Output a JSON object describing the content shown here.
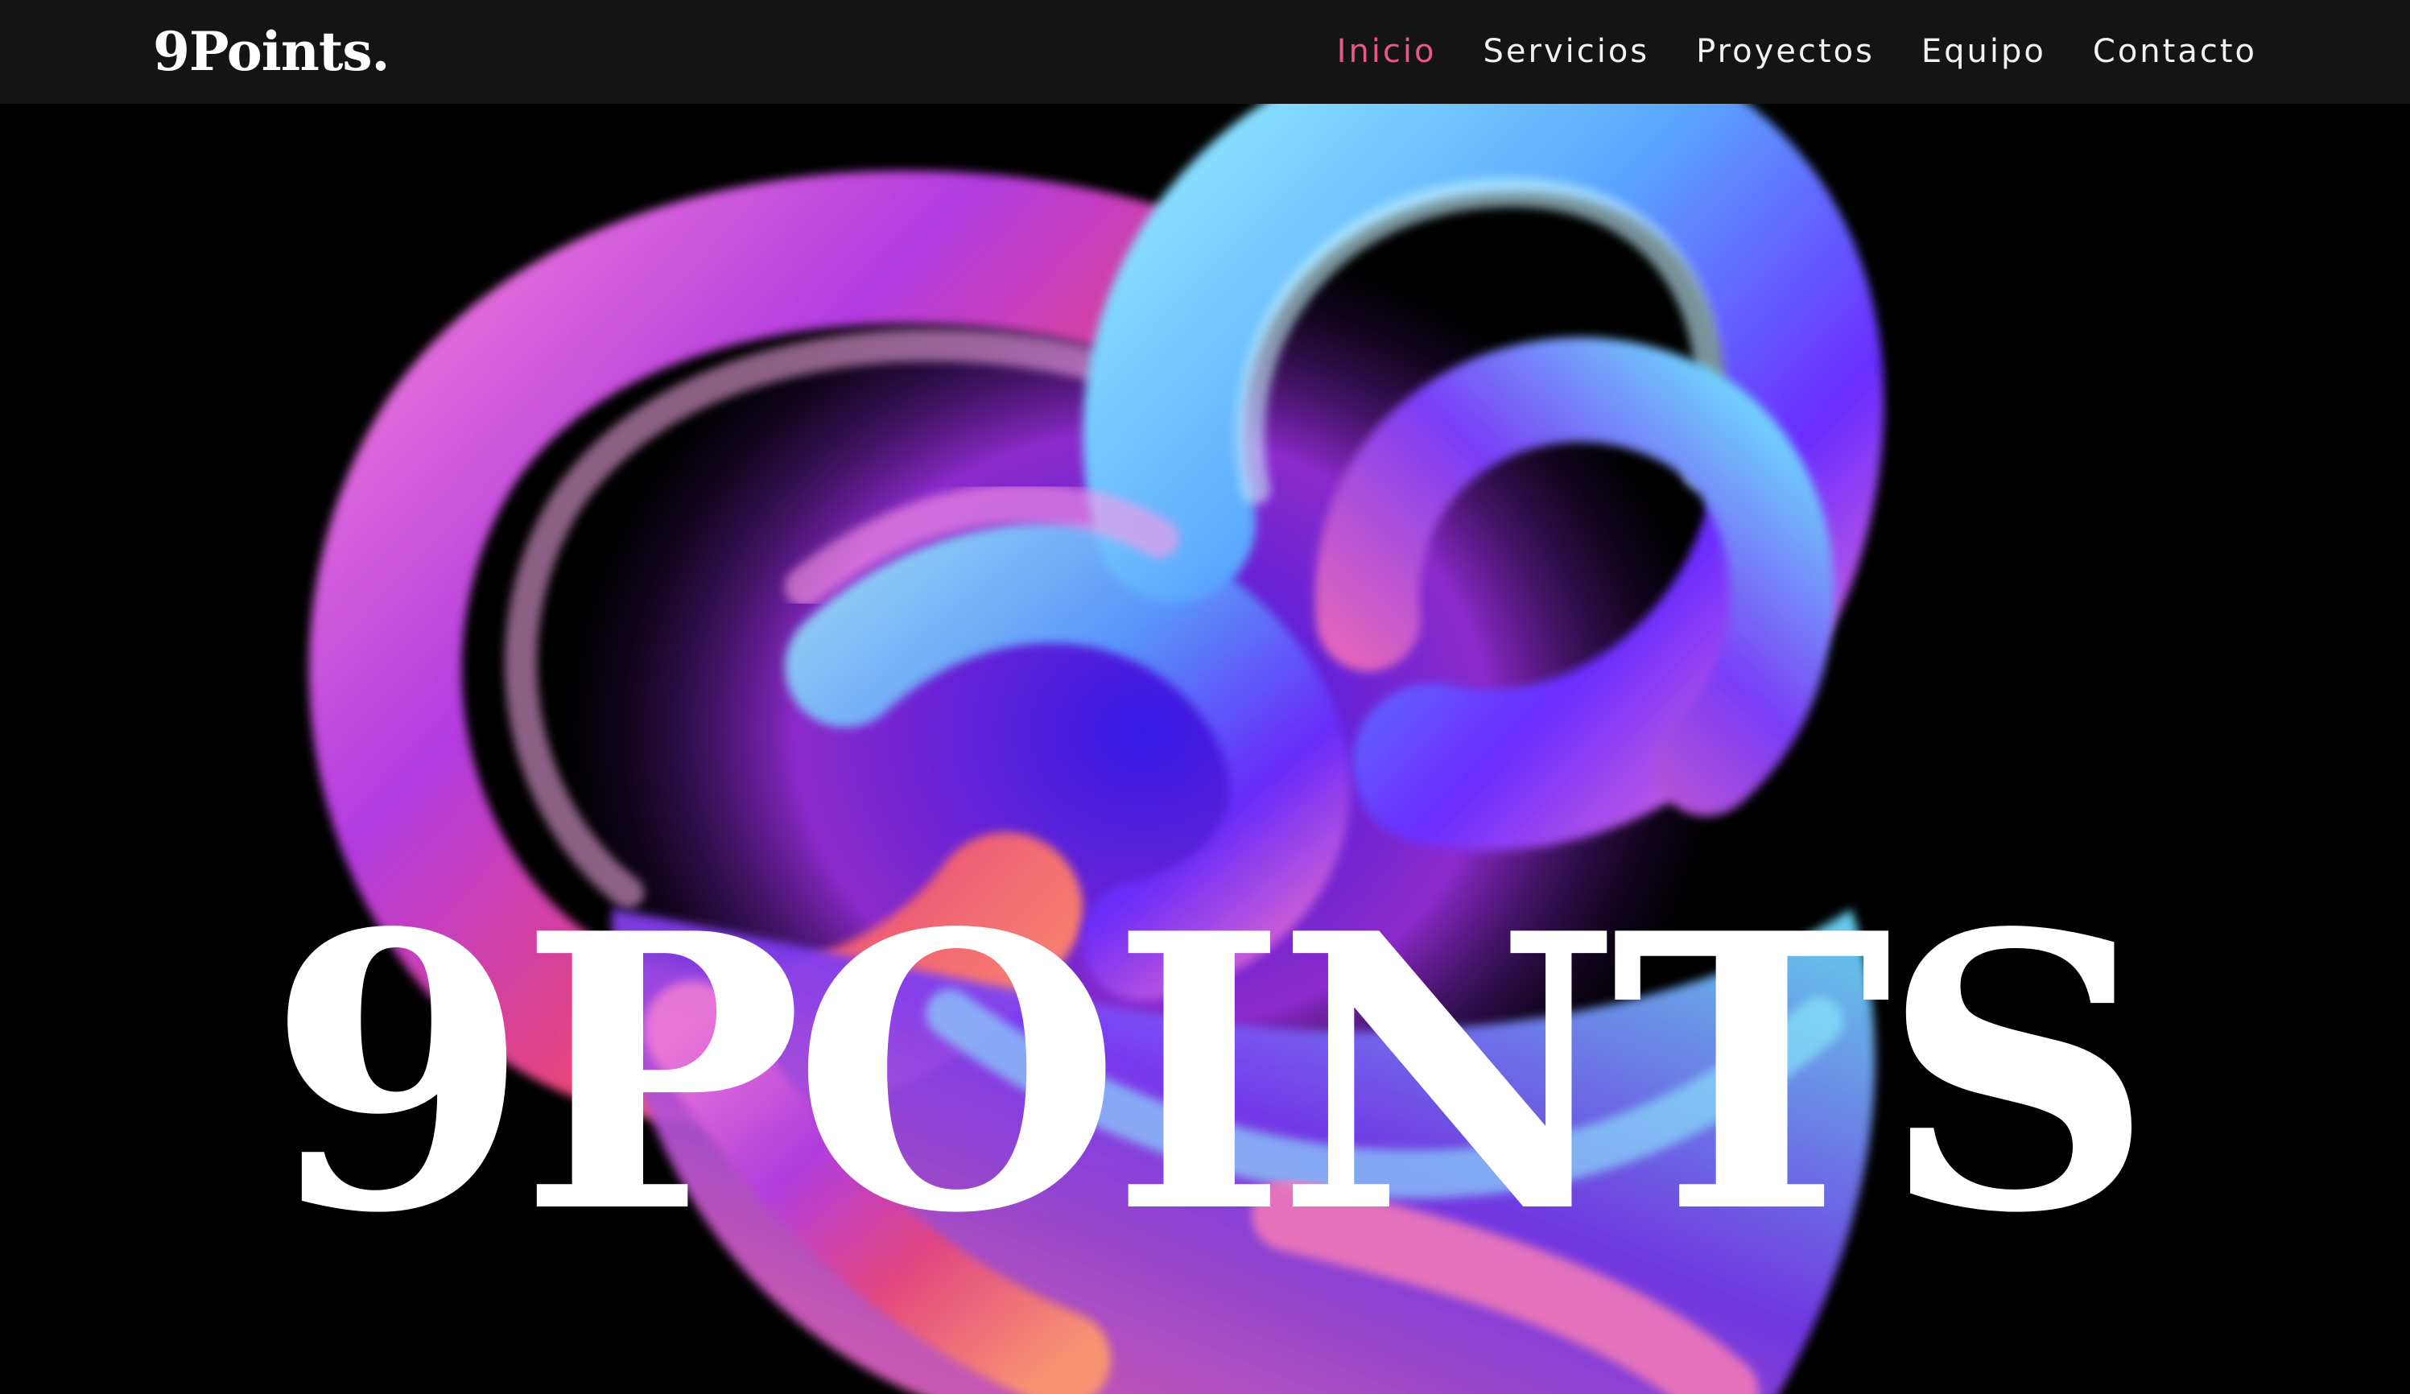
{
  "header": {
    "brand": "9Points.",
    "nav": [
      {
        "label": "Inicio",
        "active": true
      },
      {
        "label": "Servicios",
        "active": false
      },
      {
        "label": "Proyectos",
        "active": false
      },
      {
        "label": "Equipo",
        "active": false
      },
      {
        "label": "Contacto",
        "active": false
      }
    ]
  },
  "hero": {
    "title": "9POINTS",
    "artwork": "iridescent-ribbon-sculpture"
  },
  "colors": {
    "navbar_bg": "#141414",
    "page_bg": "#000000",
    "active_link": "#e8578a",
    "text": "#ffffff"
  }
}
